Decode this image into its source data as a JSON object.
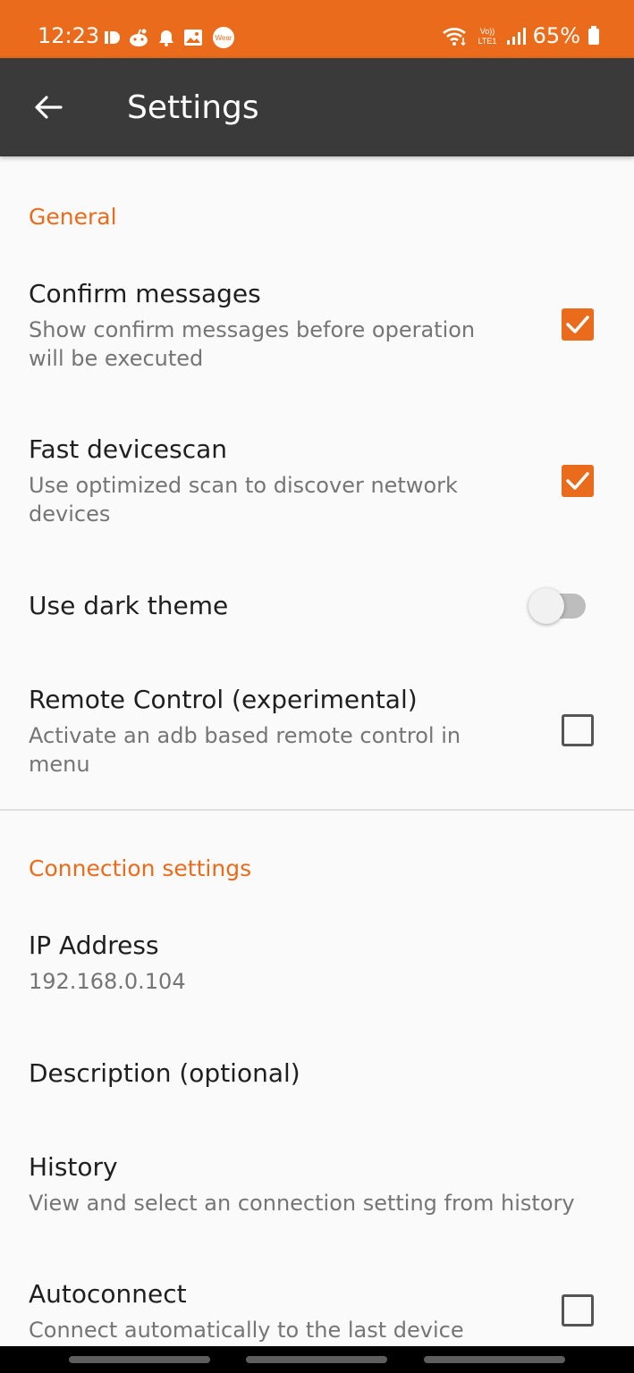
{
  "status_bar": {
    "time": "12:23",
    "battery_text": "65%",
    "left_icons": [
      "id-icon",
      "reddit-icon",
      "notification-icon",
      "gallery-icon",
      "wear-icon"
    ],
    "wear_label": "Wear",
    "network_label": "Vo)) LTE1",
    "right_icons": [
      "wifi-icon",
      "volte-icon",
      "signal-icon",
      "battery-icon"
    ]
  },
  "app_bar": {
    "title": "Settings",
    "back_icon": "arrow-left-icon"
  },
  "sections": {
    "general": {
      "header": "General",
      "confirm_messages": {
        "title": "Confirm messages",
        "summary": "Show confirm messages before operation will be executed",
        "checked": true
      },
      "fast_devicescan": {
        "title": "Fast devicescan",
        "summary": "Use optimized scan to discover network devices",
        "checked": true
      },
      "dark_theme": {
        "title": "Use dark theme",
        "enabled": false
      },
      "remote_control": {
        "title": "Remote Control (experimental)",
        "summary": "Activate an adb based remote control in menu",
        "checked": false
      }
    },
    "connection": {
      "header": "Connection settings",
      "ip_address": {
        "title": "IP Address",
        "summary": "192.168.0.104"
      },
      "description": {
        "title": "Description (optional)"
      },
      "history": {
        "title": "History",
        "summary": "View and select an connection setting from history"
      },
      "autoconnect": {
        "title": "Autoconnect",
        "summary": "Connect automatically to the last device",
        "checked": false
      }
    }
  },
  "colors": {
    "accent": "#e96b1b",
    "app_bar": "#3a3a3a",
    "background": "#fafafa",
    "title_text": "#1f1f1f",
    "summary_text": "#757575"
  }
}
